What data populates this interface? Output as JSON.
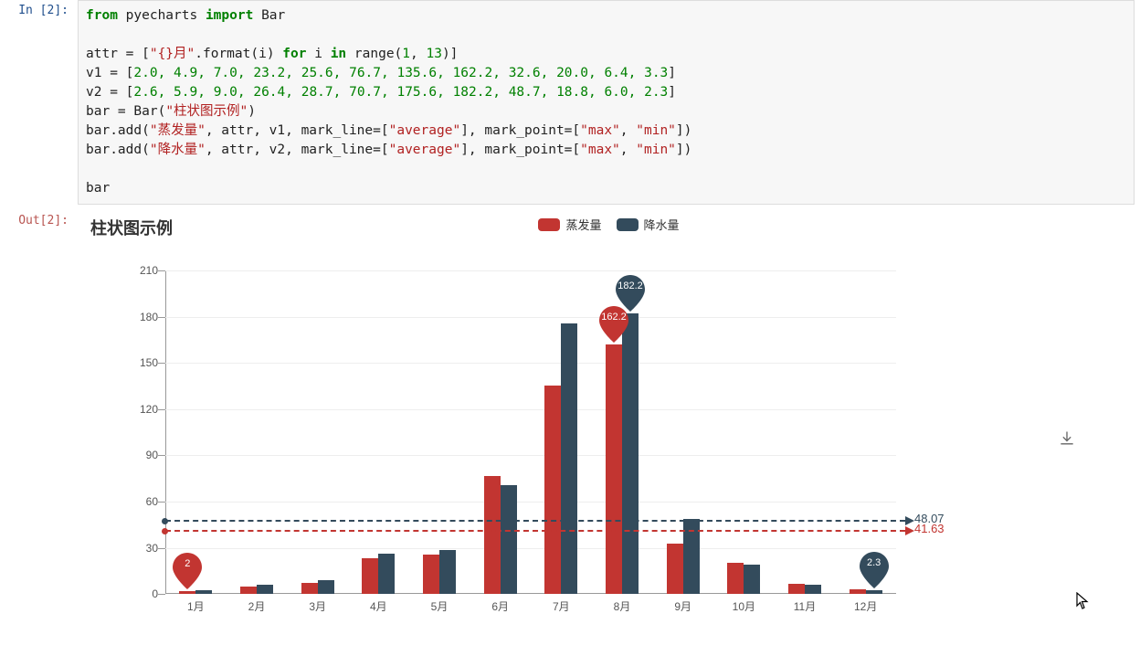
{
  "in_prompt": "In [2]:",
  "out_prompt": "Out[2]:",
  "code": {
    "l1": {
      "a": "from",
      "b": " pyecharts ",
      "c": "import",
      "d": " Bar"
    },
    "l2": {
      "a": "attr = [",
      "b": "\"{}月\"",
      "c": ".format(i) ",
      "d": "for",
      "e": " i ",
      "f": "in",
      "g": " range(",
      "h": "1",
      "i": ", ",
      "j": "13",
      "k": ")]"
    },
    "l3": {
      "a": "v1 = [",
      "vals": "2.0, 4.9, 7.0, 23.2, 25.6, 76.7, 135.6, 162.2, 32.6, 20.0, 6.4, 3.3",
      "b": "]"
    },
    "l4": {
      "a": "v2 = [",
      "vals": "2.6, 5.9, 9.0, 26.4, 28.7, 70.7, 175.6, 182.2, 48.7, 18.8, 6.0, 2.3",
      "b": "]"
    },
    "l5": {
      "a": "bar = Bar(",
      "b": "\"柱状图示例\"",
      "c": ")"
    },
    "l6": {
      "a": "bar.add(",
      "b": "\"蒸发量\"",
      "c": ", attr, v1, mark_line=[",
      "d": "\"average\"",
      "e": "], mark_point=[",
      "f": "\"max\"",
      "g": ", ",
      "h": "\"min\"",
      "i": "])"
    },
    "l7": {
      "a": "bar.add(",
      "b": "\"降水量\"",
      "c": ", attr, v2, mark_line=[",
      "d": "\"average\"",
      "e": "], mark_point=[",
      "f": "\"max\"",
      "g": ", ",
      "h": "\"min\"",
      "i": "])"
    },
    "l8": "bar"
  },
  "chart": {
    "title": "柱状图示例",
    "legend": [
      {
        "name": "蒸发量",
        "color": "#c23531"
      },
      {
        "name": "降水量",
        "color": "#334b5c"
      }
    ],
    "avg": [
      {
        "value": 41.63,
        "label": "41.63",
        "color": "#c23531"
      },
      {
        "value": 48.07,
        "label": "48.07",
        "color": "#334b5c"
      }
    ],
    "marks": [
      {
        "series": 0,
        "cat": 0,
        "value": 2.0,
        "label": "2",
        "color": "#c23531"
      },
      {
        "series": 0,
        "cat": 7,
        "value": 162.2,
        "label": "162.2",
        "color": "#c23531"
      },
      {
        "series": 1,
        "cat": 7,
        "value": 182.2,
        "label": "182.2",
        "color": "#334b5c"
      },
      {
        "series": 1,
        "cat": 11,
        "value": 2.3,
        "label": "2.3",
        "color": "#334b5c"
      }
    ]
  },
  "chart_data": {
    "type": "bar",
    "title": "柱状图示例",
    "categories": [
      "1月",
      "2月",
      "3月",
      "4月",
      "5月",
      "6月",
      "7月",
      "8月",
      "9月",
      "10月",
      "11月",
      "12月"
    ],
    "series": [
      {
        "name": "蒸发量",
        "color": "#c23531",
        "values": [
          2.0,
          4.9,
          7.0,
          23.2,
          25.6,
          76.7,
          135.6,
          162.2,
          32.6,
          20.0,
          6.4,
          3.3
        ]
      },
      {
        "name": "降水量",
        "color": "#334b5c",
        "values": [
          2.6,
          5.9,
          9.0,
          26.4,
          28.7,
          70.7,
          175.6,
          182.2,
          48.7,
          18.8,
          6.0,
          2.3
        ]
      }
    ],
    "ylim": [
      0,
      210
    ],
    "yticks": [
      0,
      30,
      60,
      90,
      120,
      150,
      180,
      210
    ],
    "xlabel": "",
    "ylabel": "",
    "mark_line": {
      "蒸发量": 41.63,
      "降水量": 48.07
    },
    "mark_point": {
      "蒸发量": {
        "max": 162.2,
        "min": 2.0
      },
      "降水量": {
        "max": 182.2,
        "min": 2.3
      }
    },
    "legend_position": "top-center"
  }
}
